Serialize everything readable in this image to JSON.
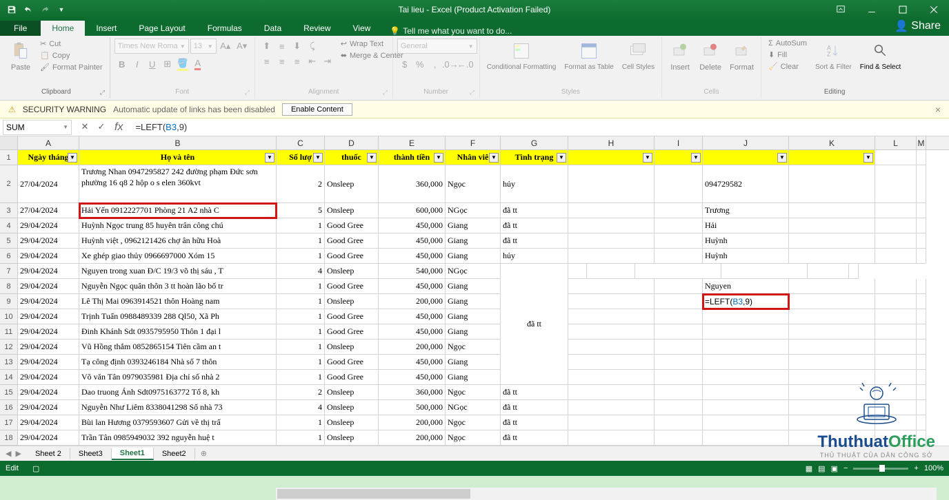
{
  "title": "Tai lieu - Excel (Product Activation Failed)",
  "tabs": {
    "file": "File",
    "home": "Home",
    "insert": "Insert",
    "pagelayout": "Page Layout",
    "formulas": "Formulas",
    "data": "Data",
    "review": "Review",
    "view": "View",
    "tellme": "Tell me what you want to do...",
    "share": "Share"
  },
  "ribbon": {
    "clipboard": {
      "label": "Clipboard",
      "paste": "Paste",
      "cut": "Cut",
      "copy": "Copy",
      "fp": "Format Painter"
    },
    "font": {
      "label": "Font",
      "name": "Times New Roma",
      "size": "13"
    },
    "alignment": {
      "label": "Alignment",
      "wrap": "Wrap Text",
      "merge": "Merge & Center"
    },
    "number": {
      "label": "Number",
      "format": "General"
    },
    "styles": {
      "label": "Styles",
      "cf": "Conditional Formatting",
      "fat": "Format as Table",
      "cs": "Cell Styles"
    },
    "cells": {
      "label": "Cells",
      "insert": "Insert",
      "delete": "Delete",
      "format": "Format"
    },
    "editing": {
      "label": "Editing",
      "autosum": "AutoSum",
      "fill": "Fill",
      "clear": "Clear",
      "sort": "Sort & Filter",
      "find": "Find & Select"
    }
  },
  "security": {
    "warning": "SECURITY WARNING",
    "msg": "Automatic update of links has been disabled",
    "btn": "Enable Content"
  },
  "namebox": "SUM",
  "formula": {
    "prefix": "=LEFT(",
    "ref": "B3",
    "suffix": ",9)"
  },
  "columns": [
    "A",
    "B",
    "C",
    "D",
    "E",
    "F",
    "G",
    "H",
    "I",
    "J",
    "K",
    "L",
    "M"
  ],
  "headers": {
    "A": "Ngày tháng",
    "B": "Họ và tên",
    "C": "Số lượ",
    "D": "thuốc",
    "E": "thành tiền",
    "F": "Nhân viê",
    "G": "Tình trạng",
    "H": "",
    "I": "",
    "J": "",
    "K": ""
  },
  "rows": [
    {
      "r": 2,
      "tall": true,
      "A": "27/04/2024",
      "B": "Trương Nhan 0947295827 242 đường phạm Đức sơn phường 16 q8 2 hộp o s elen 360kvt",
      "C": "2",
      "D": "Onsleep",
      "E": "360,000",
      "F": "Ngọc",
      "G": "hủy",
      "J": "094729582"
    },
    {
      "r": 3,
      "A": "27/04/2024",
      "B": "Hải Yến 0912227701 Phòng 21 A2 nhà C",
      "C": "5",
      "D": "Onsleep",
      "E": "600,000",
      "F": "NGọc",
      "G": "đã tt",
      "J": "Trương",
      "Bhl": true
    },
    {
      "r": 4,
      "A": "29/04/2024",
      "B": "Huỳnh Ngọc trung 85 huyên trân công chú",
      "C": "1",
      "D": "Good Gree",
      "E": "450,000",
      "F": "Giang",
      "G": "đã tt",
      "J": "Hải"
    },
    {
      "r": 5,
      "A": "29/04/2024",
      "B": "Huỳnh việt , 0962121426 chợ ân hữu Hoà",
      "C": "1",
      "D": "Good Gree",
      "E": "450,000",
      "F": "Giang",
      "G": "đã tt",
      "J": "Huỳnh"
    },
    {
      "r": 6,
      "A": "29/04/2024",
      "B": " Xe ghép giao thủy 0966697000 Xóm 15",
      "C": "1",
      "D": "Good Gree",
      "E": "450,000",
      "F": "Giang",
      "G": "hủy",
      "J": "Huỳnh"
    },
    {
      "r": 7,
      "A": "29/04/2024",
      "B": "Nguyen trong xuan Đ/C 19/3 võ thị sáu , T",
      "C": "4",
      "D": "Onsleep",
      "E": "540,000",
      "F": "NGọc",
      "J": "",
      "mergeStart": true
    },
    {
      "r": 8,
      "A": "29/04/2024",
      "B": "Nguyễn Ngọc quân thôn 3 tt hoàn lão bố tr",
      "C": "1",
      "D": "Good Gree",
      "E": "450,000",
      "F": "Giang",
      "J": "Nguyen"
    },
    {
      "r": 9,
      "A": "29/04/2024",
      "B": "Lê Thị Mai 0963914521 thôn Hoàng nam",
      "C": "1",
      "D": "Onsleep",
      "E": "200,000",
      "F": "Giang",
      "Jformula": true,
      "Jhl": true
    },
    {
      "r": 10,
      "A": "29/04/2024",
      "B": "Trịnh Tuấn 0988489339 288 Ql50, Xã Ph",
      "C": "1",
      "D": "Good Gree",
      "E": "450,000",
      "F": "Giang"
    },
    {
      "r": 11,
      "A": "29/04/2024",
      "B": "Đinh Khánh Sdt 0935795950 Thôn 1 đại l",
      "C": "1",
      "D": "Good Gree",
      "E": "450,000",
      "F": "Giang"
    },
    {
      "r": 12,
      "A": "29/04/2024",
      "B": "Vũ Hồng thắm 0852865154 Tiên cầm an t",
      "C": "1",
      "D": "Onsleep",
      "E": "200,000",
      "F": "Ngọc"
    },
    {
      "r": 13,
      "A": "29/04/2024",
      "B": "Tạ công định 0393246184 Nhà số 7 thôn",
      "C": "1",
      "D": "Good Gree",
      "E": "450,000",
      "F": "Giang"
    },
    {
      "r": 14,
      "A": "29/04/2024",
      "B": " Võ văn Tân 0979035981 Địa chỉ số nhà 2",
      "C": "1",
      "D": "Good Gree",
      "E": "450,000",
      "F": "Giang",
      "mergeEnd": true
    },
    {
      "r": 15,
      "A": "29/04/2024",
      "B": "Dao truong Ánh  Sdt0975163772 Tổ 8, kh",
      "C": "2",
      "D": "Onsleep",
      "E": "360,000",
      "F": "Ngọc",
      "G": "đã tt"
    },
    {
      "r": 16,
      "A": "29/04/2024",
      "B": "Nguyễn Như Liêm 8338041298 Số nhà 73",
      "C": "4",
      "D": "Onsleep",
      "E": "500,000",
      "F": "NGọc",
      "G": "đã tt"
    },
    {
      "r": 17,
      "A": "29/04/2024",
      "B": "Bùi lan Hương 0379593607 Gửi về thị trấ",
      "C": "1",
      "D": "Onsleep",
      "E": "200,000",
      "F": "Ngọc",
      "G": "đã tt"
    },
    {
      "r": 18,
      "A": "29/04/2024",
      "B": "Trần Tân 0985949032 392 nguyễn huệ t",
      "C": "1",
      "D": "Onsleep",
      "E": "200,000",
      "F": "Ngọc",
      "G": "đã tt"
    }
  ],
  "mergedG": "đã tt",
  "sheets": {
    "s2": "Sheet 2",
    "s3": "Sheet3",
    "s1": "Sheet1",
    "sa": "Sheet2"
  },
  "status": {
    "mode": "Edit",
    "zoom": "100%"
  },
  "watermark": {
    "text1": "Thuthuat",
    "text2": "Office",
    "sub": "THỦ THUẬT CỦA DÂN CÔNG SỞ"
  }
}
